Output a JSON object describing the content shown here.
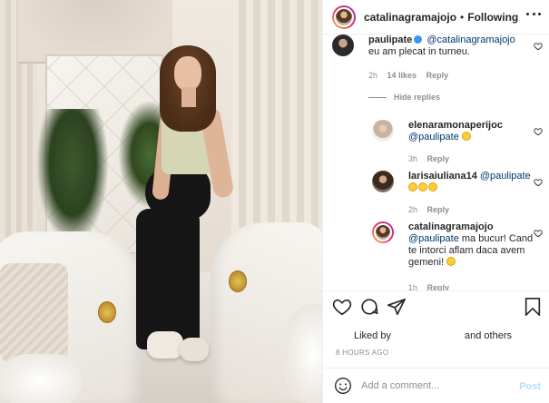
{
  "post": {
    "username": "catalinagramajojo",
    "separator": "•",
    "follow_status": "Following"
  },
  "comments": [
    {
      "username": "paulipate",
      "verified": true,
      "mention": "@catalinagramajojo",
      "text": "eu am plecat in turneu.",
      "age": "2h",
      "likes": "14 likes",
      "reply": "Reply"
    }
  ],
  "hide_replies": "Hide replies",
  "replies": [
    {
      "username": "elenaramonaperijoc",
      "mention": "@paulipate",
      "emojis": [
        "grinning"
      ],
      "age": "3h",
      "reply": "Reply"
    },
    {
      "username": "larisaiuliana14",
      "mention": "@paulipate",
      "emojis": [
        "grinning",
        "grinning",
        "grinning"
      ],
      "age": "2h",
      "reply": "Reply"
    },
    {
      "username": "catalinagramajojo",
      "mention": "@paulipate",
      "text": "ma bucur! Cand te intorci aflam daca avem gemeni!",
      "emojis": [
        "grinning"
      ],
      "age": "1h",
      "reply": "Reply"
    }
  ],
  "actions": {
    "like": "heart-icon",
    "comment": "comment-icon",
    "share": "share-icon",
    "save": "bookmark-icon"
  },
  "liked_by": {
    "prefix": "Liked by",
    "suffix": "and others"
  },
  "timestamp": "8 HOURS AGO",
  "add_comment": {
    "placeholder": "Add a comment...",
    "post_label": "Post"
  },
  "colors": {
    "text": "#262626",
    "secondary": "#8e8e8e",
    "link": "#00376b",
    "post_disabled": "#b2dffc"
  }
}
